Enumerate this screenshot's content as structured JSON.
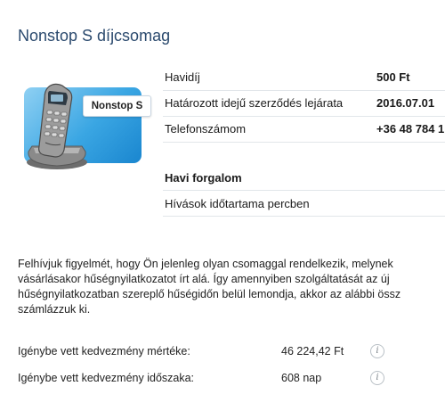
{
  "page_title": "Nonstop S díjcsomag",
  "plan": {
    "image_label": "Nonstop S"
  },
  "details": [
    {
      "label": "Havidíj",
      "value": "500 Ft"
    },
    {
      "label": "Határozott idejű szerződés lejárata",
      "value": "2016.07.01"
    },
    {
      "label": "Telefonszámom",
      "value": "+36 48 784 1"
    }
  ],
  "traffic": {
    "heading": "Havi forgalom",
    "row_label": "Hívások időtartama percben"
  },
  "notice_lines": [
    "Felhívjuk figyelmét, hogy Ön jelenleg olyan csomaggal rendelkezik, melynek",
    "vásárlásakor hűségnyilatkozatot írt alá. Így amennyiben szolgáltatását az új",
    "hűségnyilatkozatban szereplő hűségidőn belül lemondja, akkor az alábbi össz",
    "számlázzuk ki."
  ],
  "discount": [
    {
      "label": "Igénybe vett kedvezmény mértéke:",
      "value": "46 224,42 Ft",
      "icon": "info-icon"
    },
    {
      "label": "Igénybe vett kedvezmény időszaka:",
      "value": "608 nap",
      "icon": "info-icon"
    }
  ],
  "colors": {
    "title": "#2b4a6e",
    "card_blue": "#3aa6e3",
    "divider": "#e2e6ea"
  }
}
